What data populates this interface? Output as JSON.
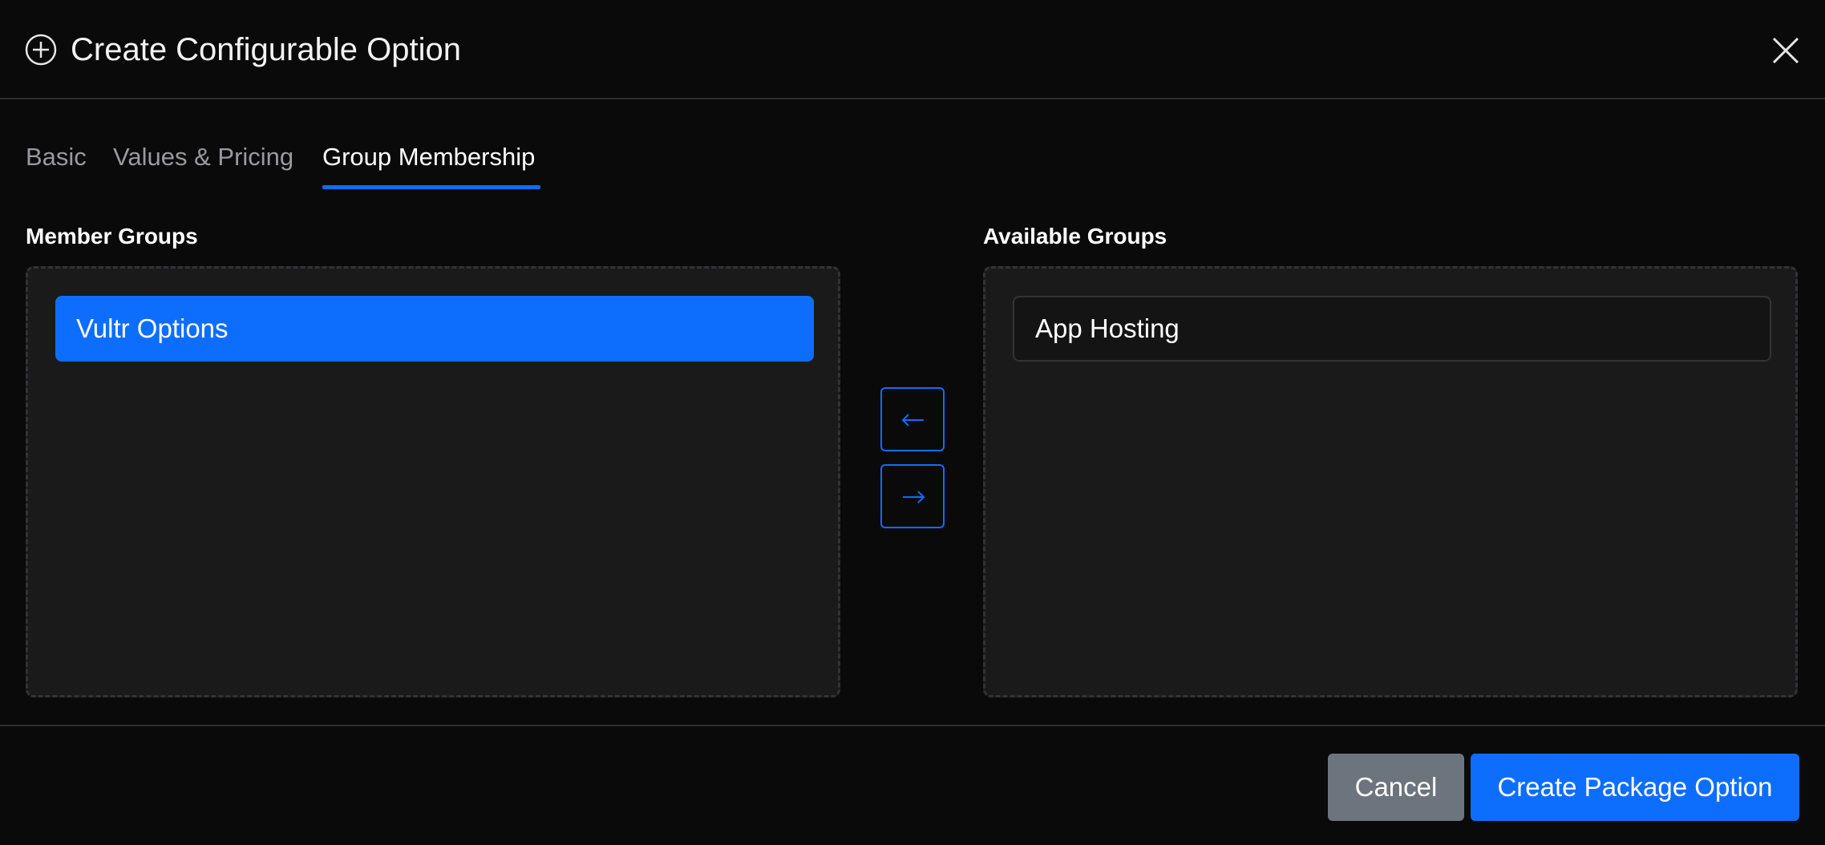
{
  "modal": {
    "title": "Create Configurable Option",
    "title_icon": "plus-circle-icon",
    "close_icon": "close-icon"
  },
  "tabs": [
    {
      "label": "Basic",
      "active": false
    },
    {
      "label": "Values & Pricing",
      "active": false
    },
    {
      "label": "Group Membership",
      "active": true
    }
  ],
  "member_groups": {
    "label": "Member Groups",
    "items": [
      {
        "label": "Vultr Options",
        "selected": true
      }
    ]
  },
  "available_groups": {
    "label": "Available Groups",
    "items": [
      {
        "label": "App Hosting",
        "selected": false
      }
    ]
  },
  "move_buttons": {
    "left_icon": "arrow-left-icon",
    "right_icon": "arrow-right-icon"
  },
  "footer": {
    "cancel_label": "Cancel",
    "submit_label": "Create Package Option"
  },
  "colors": {
    "accent": "#0d6efd",
    "background": "#0a0a0b",
    "panel": "#1a1a1b",
    "cancel": "#6c757d"
  }
}
